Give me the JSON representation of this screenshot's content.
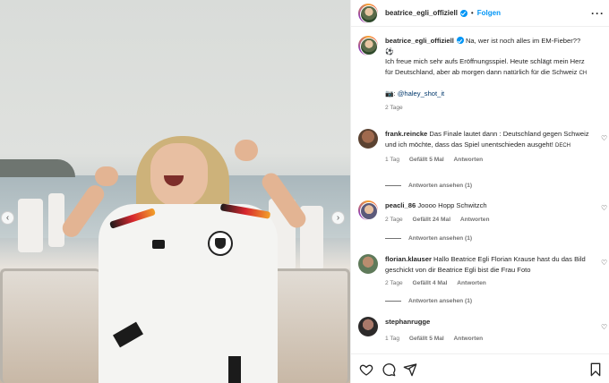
{
  "post": {
    "username": "beatrice_egli_offiziell",
    "follow_label": "Folgen",
    "separator": "•",
    "more_label": "···"
  },
  "caption": {
    "username": "beatrice_egli_offiziell",
    "line1": "Na, wer ist noch alles im EM-Fieber??",
    "emoji1": "⚽",
    "body": "Ich freue mich sehr aufs Eröffnungsspiel. Heute schlägt mein Herz für Deutschland, aber ab morgen dann natürlich für die Schweiz",
    "flag_ch": "CH",
    "camera_emoji": "📷",
    "credit_prefix": ": ",
    "credit_link": "@haley_shot_it",
    "time": "2 Tage"
  },
  "comments": [
    {
      "username": "frank.reincke",
      "text": "Das Finale lautet dann : Deutschland gegen Schweiz und ich möchte, dass das Spiel unentschieden ausgeht!",
      "suffix": "DECH",
      "time": "1 Tag",
      "likes": "Gefällt 5 Mal",
      "reply": "Antworten",
      "replies": "Antworten ansehen (1)"
    },
    {
      "username": "peacli_86",
      "text": "Joooo",
      "suffix": "Hopp Schwitzch",
      "time": "2 Tage",
      "likes": "Gefällt 24 Mal",
      "reply": "Antworten",
      "replies": "Antworten ansehen (1)"
    },
    {
      "username": "florian.klauser",
      "text": "Hallo Beatrice Egli Florian Krause hast du das Bild geschickt von dir Beatrice Egli bist die Frau Foto",
      "suffix": "",
      "time": "2 Tage",
      "likes": "Gefällt 4 Mal",
      "reply": "Antworten",
      "replies": "Antworten ansehen (1)"
    },
    {
      "username": "stephanrugge",
      "text": "",
      "suffix": "",
      "time": "1 Tag",
      "likes": "Gefällt 5 Mal",
      "reply": "Antworten",
      "replies": ""
    }
  ],
  "icons": {
    "like": "heart-icon",
    "comment": "comment-icon",
    "share": "share-icon",
    "save": "bookmark-icon",
    "prev": "chevron-left-icon",
    "next": "chevron-right-icon"
  },
  "nav": {
    "prev_glyph": "‹",
    "next_glyph": "›"
  },
  "colors": {
    "accent": "#0095f6",
    "muted": "#737373",
    "text": "#262626"
  }
}
